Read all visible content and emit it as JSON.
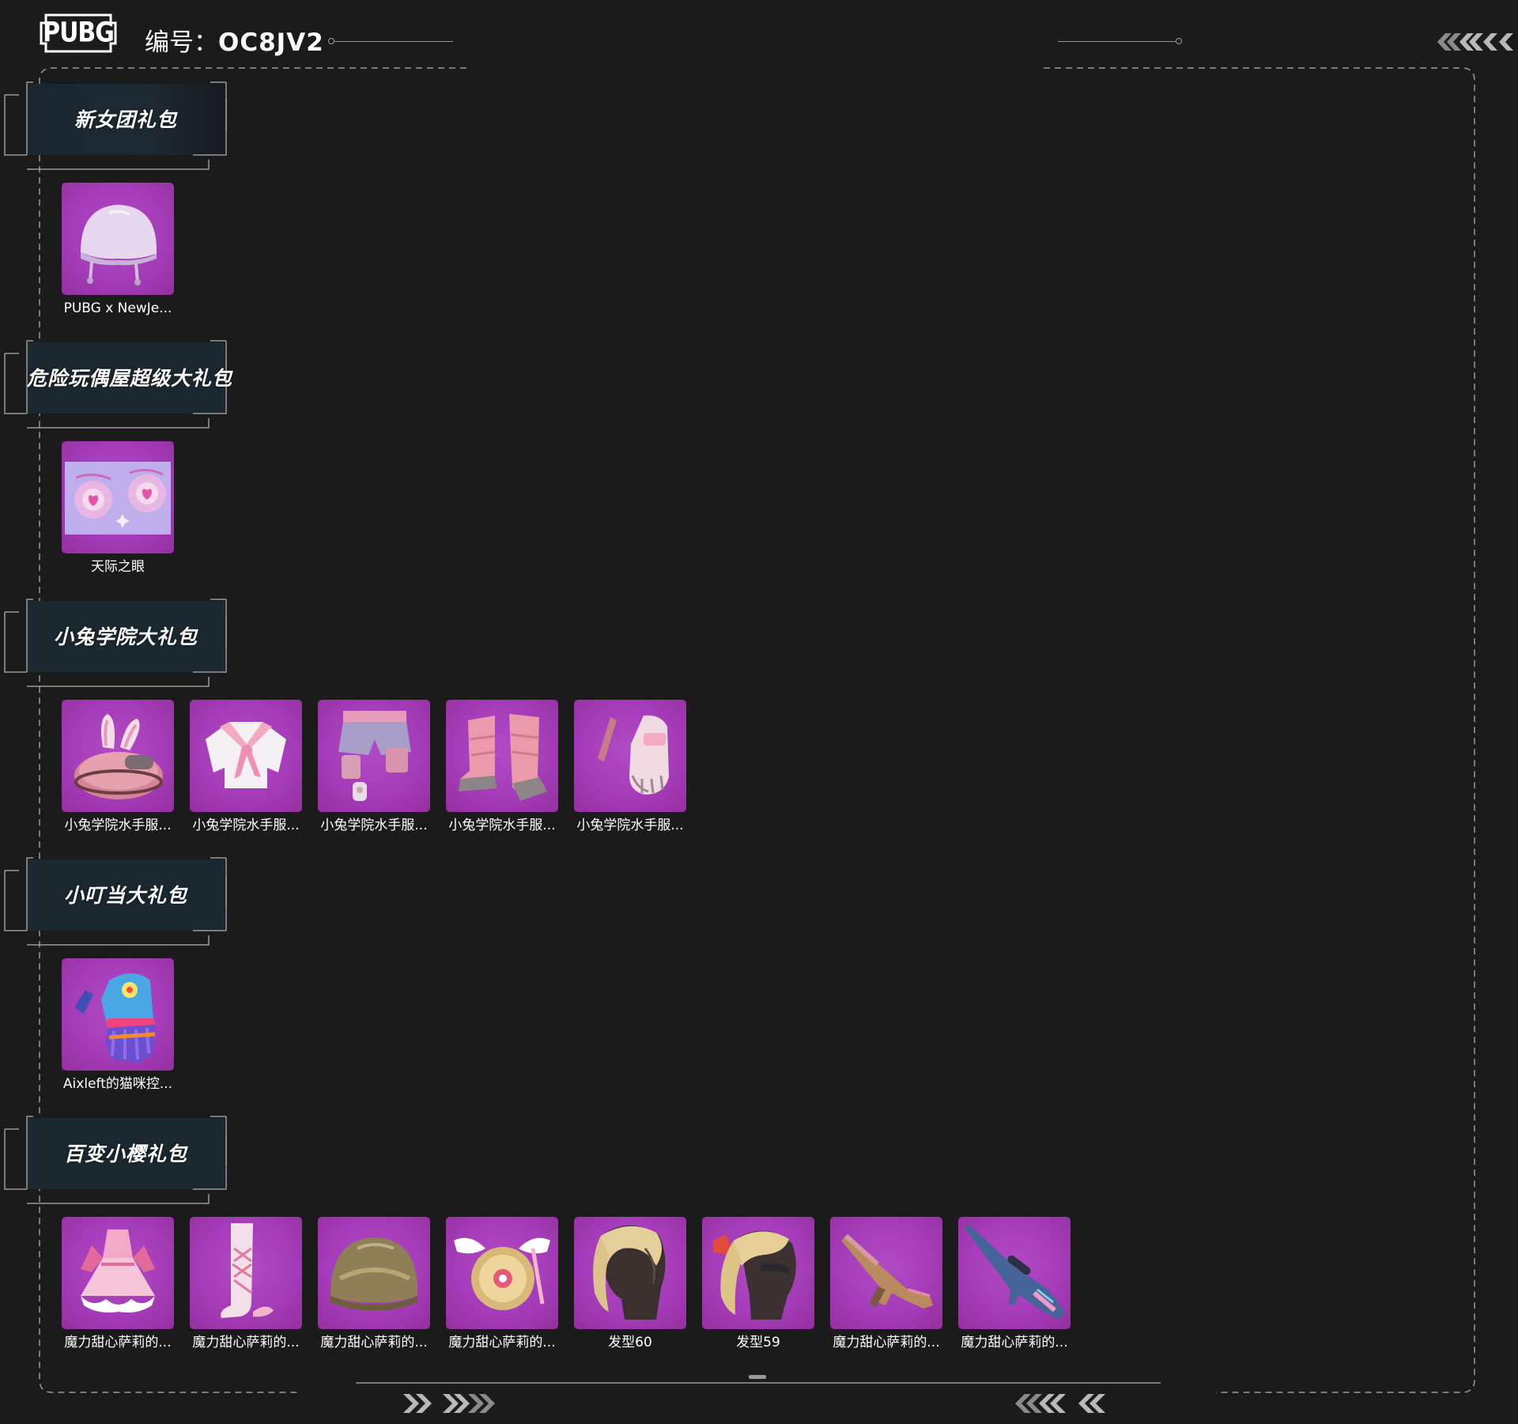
{
  "header": {
    "logo_text": "PUBG",
    "serial_label": "编号：",
    "serial_value": "OC8JV2"
  },
  "colors": {
    "background": "#1b1b1c",
    "tile_purple": "#a53cb9",
    "frame_line": "#9a9a9b"
  },
  "sections": [
    {
      "title": "新女团礼包",
      "items": [
        {
          "name": "PUBG x NewJe...",
          "icon": "helmet-icon"
        }
      ]
    },
    {
      "title": "危险玩偶屋超级大礼包",
      "items": [
        {
          "name": "天际之眼",
          "icon": "heart-eyes-screen-icon"
        }
      ]
    },
    {
      "title": "小兔学院大礼包",
      "items": [
        {
          "name": "小兔学院水手服...",
          "icon": "bunny-helmet-icon"
        },
        {
          "name": "小兔学院水手服...",
          "icon": "sailor-top-icon"
        },
        {
          "name": "小兔学院水手服...",
          "icon": "shorts-icon"
        },
        {
          "name": "小兔学院水手服...",
          "icon": "boots-icon"
        },
        {
          "name": "小兔学院水手服...",
          "icon": "gloves-icon"
        }
      ]
    },
    {
      "title": "小叮当大礼包",
      "items": [
        {
          "name": "Aixleft的猫咪控...",
          "icon": "glove-icon"
        }
      ]
    },
    {
      "title": "百变小樱礼包",
      "items": [
        {
          "name": "魔力甜心萨莉的...",
          "icon": "dress-icon"
        },
        {
          "name": "魔力甜心萨莉的...",
          "icon": "stockings-icon"
        },
        {
          "name": "魔力甜心萨莉的...",
          "icon": "gold-helmet-icon"
        },
        {
          "name": "魔力甜心萨莉的...",
          "icon": "winged-backpack-icon"
        },
        {
          "name": "发型60",
          "icon": "hair-ponytail-icon"
        },
        {
          "name": "发型59",
          "icon": "hair-bow-icon"
        },
        {
          "name": "魔力甜心萨莉的...",
          "icon": "rifle-icon"
        },
        {
          "name": "魔力甜心萨莉的...",
          "icon": "sniper-rifle-icon"
        }
      ]
    }
  ]
}
